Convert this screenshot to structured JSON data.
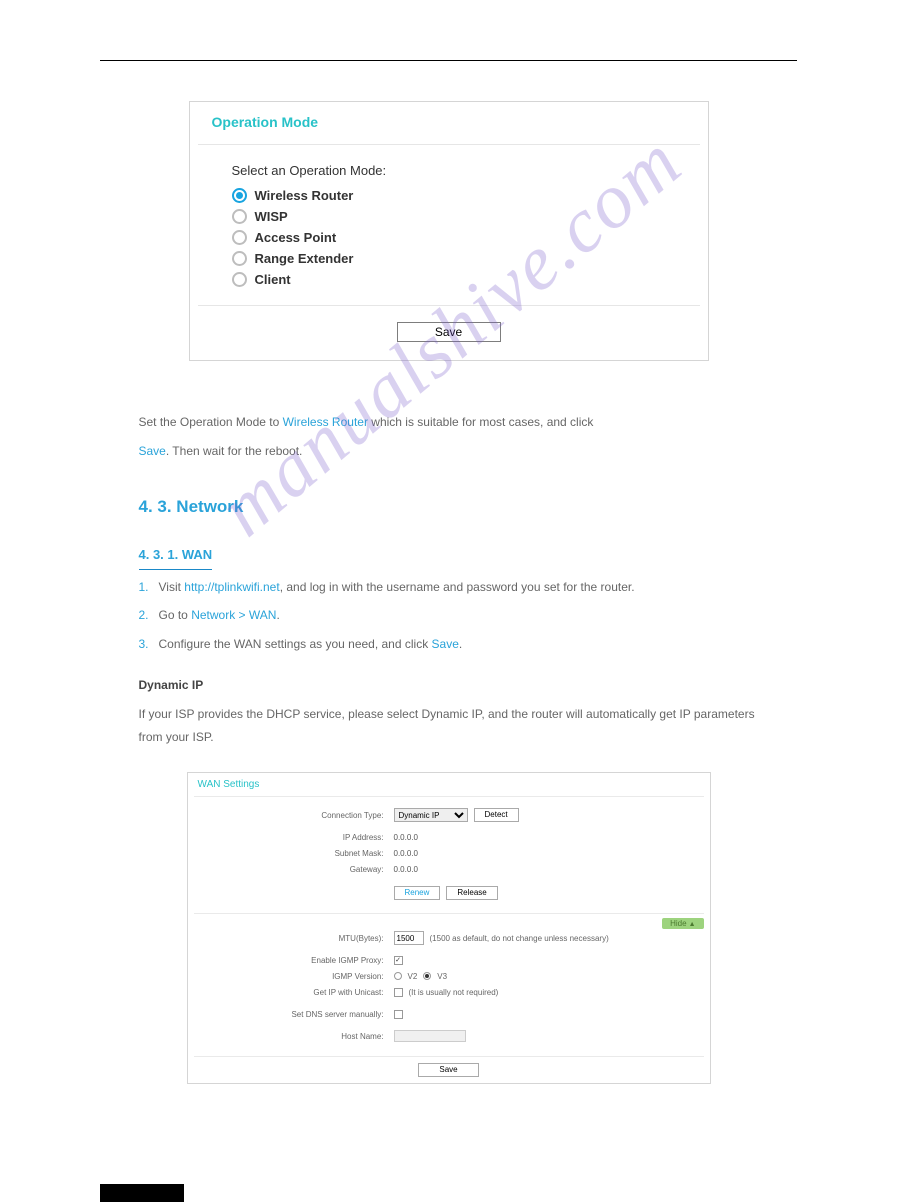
{
  "watermark": "manualshive.com",
  "panel1": {
    "title": "Operation Mode",
    "select_label": "Select an Operation Mode:",
    "options": [
      {
        "label": "Wireless Router",
        "checked": true
      },
      {
        "label": "WISP",
        "checked": false
      },
      {
        "label": "Access Point",
        "checked": false
      },
      {
        "label": "Range Extender",
        "checked": false
      },
      {
        "label": "Client",
        "checked": false
      }
    ],
    "save": "Save"
  },
  "body": {
    "h1": "4. 3. Network",
    "h2": "4. 3. 1. WAN",
    "intro1": "Set the Operation Mode to ",
    "intro1b": "Wireless Router",
    "intro1c": " which is suitable for most cases, and click",
    "intro2": ". Then wait for the reboot.",
    "intro_save": "Save",
    "step1a": "Visit ",
    "step1_url": "http://tplinkwifi.net",
    "step1b": ", and log in with the username and password you set for the router.",
    "step2a": "Go to ",
    "step2_path": "Network > WAN",
    "step2b": ".",
    "step3": "Configure the WAN settings as you need, and click ",
    "step3_save": "Save",
    "step1_num": "1.",
    "step2_num": "2.",
    "step3_num": "3.",
    "dyn_h": "Dynamic IP",
    "dyn_p": "If your ISP provides the DHCP service, please select Dynamic IP, and the router will automatically get IP parameters from your ISP."
  },
  "panel2": {
    "title": "WAN Settings",
    "conn_type_label": "Connection Type:",
    "conn_type_value": "Dynamic IP",
    "detect": "Detect",
    "ip_label": "IP Address:",
    "ip_value": "0.0.0.0",
    "mask_label": "Subnet Mask:",
    "mask_value": "0.0.0.0",
    "gw_label": "Gateway:",
    "gw_value": "0.0.0.0",
    "renew": "Renew",
    "release": "Release",
    "hide": "Hide",
    "mtu_label": "MTU(Bytes):",
    "mtu_value": "1500",
    "mtu_hint": "(1500 as default, do not change unless necessary)",
    "igmp_proxy_label": "Enable IGMP Proxy:",
    "igmp_ver_label": "IGMP Version:",
    "igmp_v2": "V2",
    "igmp_v3": "V3",
    "unicast_label": "Get IP with Unicast:",
    "unicast_hint": "(It is usually not required)",
    "dns_manual_label": "Set DNS server manually:",
    "host_label": "Host Name:",
    "save": "Save"
  }
}
